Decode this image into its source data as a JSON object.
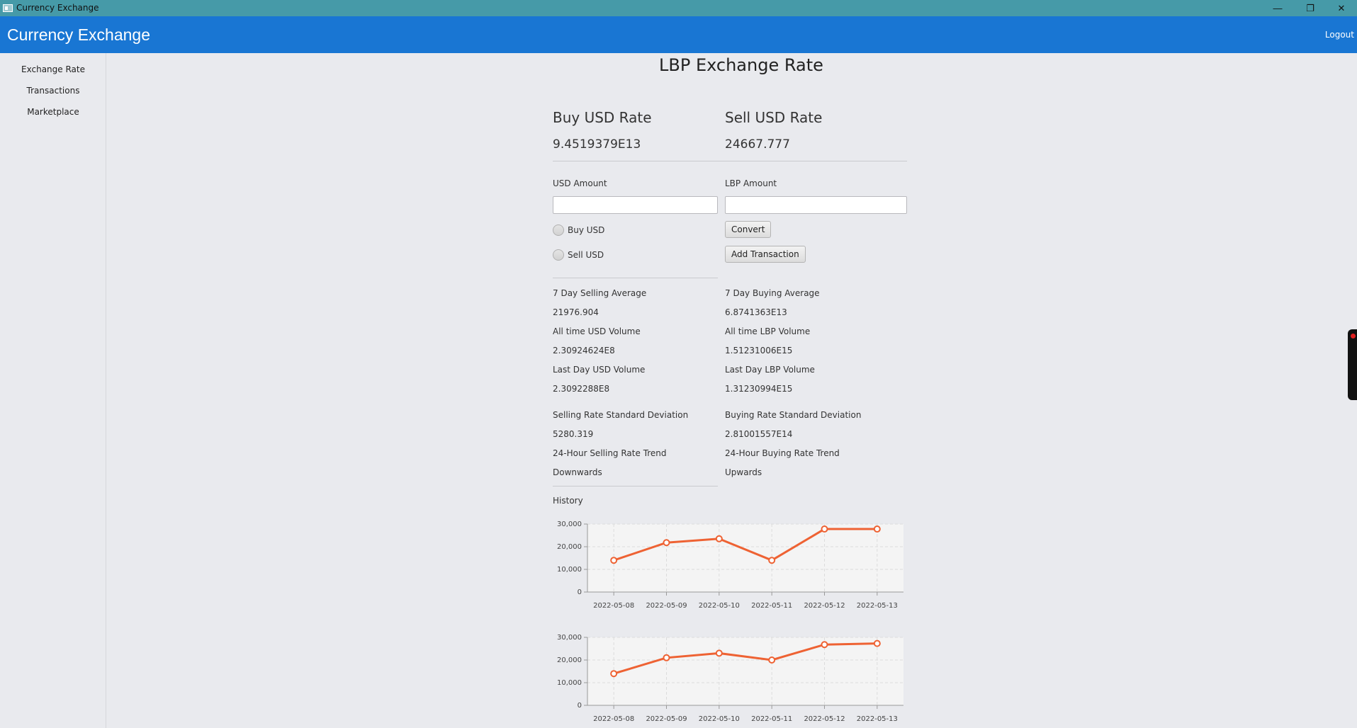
{
  "window": {
    "title": "Currency Exchange",
    "controls": {
      "minimize": "—",
      "restore": "❐",
      "close": "✕"
    }
  },
  "header": {
    "brand": "Currency Exchange",
    "logout": "Logout"
  },
  "sidebar": {
    "items": [
      {
        "label": "Exchange Rate"
      },
      {
        "label": "Transactions"
      },
      {
        "label": "Marketplace"
      }
    ]
  },
  "main": {
    "title": "LBP Exchange Rate",
    "buy": {
      "label": "Buy USD Rate",
      "value": "9.4519379E13"
    },
    "sell": {
      "label": "Sell USD Rate",
      "value": "24667.777"
    },
    "form": {
      "usd_label": "USD Amount",
      "usd_value": "",
      "lbp_label": "LBP Amount",
      "lbp_value": "",
      "buy_radio": "Buy USD",
      "sell_radio": "Sell USD",
      "convert": "Convert",
      "add_transaction": "Add Transaction"
    },
    "stats": {
      "left": [
        {
          "label": "7 Day Selling Average",
          "value": "21976.904"
        },
        {
          "label": "All time USD Volume",
          "value": "2.30924624E8"
        },
        {
          "label": "Last Day USD Volume",
          "value": "2.3092288E8"
        },
        {
          "label": "Selling Rate Standard Deviation",
          "value": "5280.319"
        },
        {
          "label": "24-Hour Selling Rate Trend",
          "value": "Downwards"
        }
      ],
      "right": [
        {
          "label": "7 Day Buying Average",
          "value": "6.8741363E13"
        },
        {
          "label": "All time LBP Volume",
          "value": "1.51231006E15"
        },
        {
          "label": "Last Day LBP Volume",
          "value": "1.31230994E15"
        },
        {
          "label": "Buying Rate Standard Deviation",
          "value": "2.81001557E14"
        },
        {
          "label": "24-Hour Buying Rate Trend",
          "value": "Upwards"
        }
      ]
    },
    "history_label": "History"
  },
  "colors": {
    "line": "#ee6233",
    "plot_bg": "#f4f4f4",
    "grid": "#dcdcdc"
  },
  "chart_data": [
    {
      "type": "line",
      "categories": [
        "2022-05-08",
        "2022-05-09",
        "2022-05-10",
        "2022-05-11",
        "2022-05-12",
        "2022-05-13"
      ],
      "values": [
        14000,
        21800,
        23500,
        14000,
        27800,
        27800
      ],
      "yticks": [
        "0",
        "10,000",
        "20,000",
        "30,000"
      ],
      "ylim": [
        0,
        30000
      ],
      "grid": true
    },
    {
      "type": "line",
      "categories": [
        "2022-05-08",
        "2022-05-09",
        "2022-05-10",
        "2022-05-11",
        "2022-05-12",
        "2022-05-13"
      ],
      "values": [
        14000,
        21000,
        23000,
        20000,
        26800,
        27300
      ],
      "yticks": [
        "0",
        "10,000",
        "20,000",
        "30,000"
      ],
      "ylim": [
        0,
        30000
      ],
      "grid": true
    }
  ],
  "overlay": {
    "label": "screenrec"
  }
}
